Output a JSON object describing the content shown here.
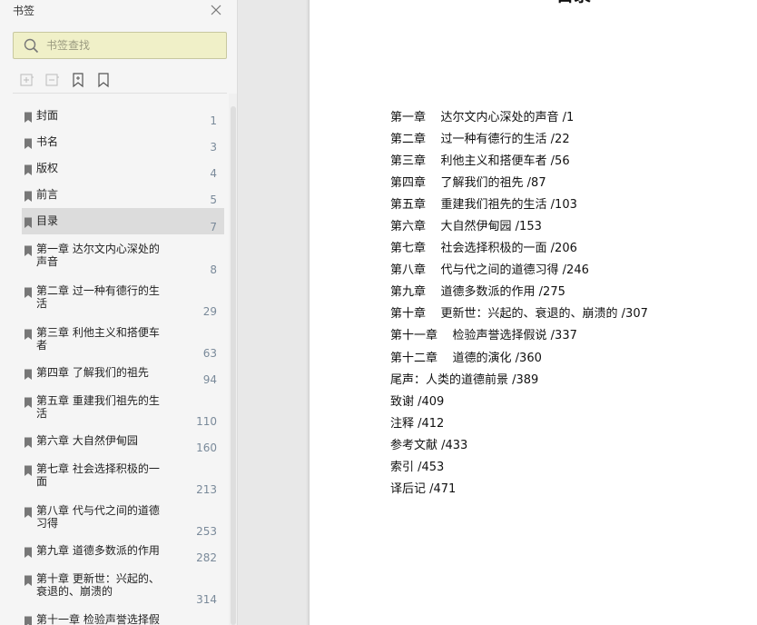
{
  "sidebar": {
    "title": "书签",
    "search": {
      "placeholder": "书签查找",
      "value": ""
    },
    "toolbar": {
      "expand_icon": "expand-all-icon",
      "collapse_icon": "collapse-all-icon",
      "add_bookmark_icon": "add-bookmark-icon",
      "bookmark_icon": "bookmark-icon"
    },
    "items": [
      {
        "label": "封面",
        "page": "1"
      },
      {
        "label": "书名",
        "page": "3"
      },
      {
        "label": "版权",
        "page": "4"
      },
      {
        "label": "前言",
        "page": "5"
      },
      {
        "label": "目录",
        "page": "7",
        "selected": true
      },
      {
        "label": "第一章  达尔文内心深处的声音",
        "page": "8"
      },
      {
        "label": "第二章  过一种有德行的生活",
        "page": "29"
      },
      {
        "label": "第三章  利他主义和搭便车者",
        "page": "63"
      },
      {
        "label": "第四章  了解我们的祖先",
        "page": "94"
      },
      {
        "label": "第五章  重建我们祖先的生活",
        "page": "110"
      },
      {
        "label": "第六章  大自然伊甸园",
        "page": "160"
      },
      {
        "label": "第七章  社会选择积极的一面",
        "page": "213"
      },
      {
        "label": "第八章  代与代之间的道德习得",
        "page": "253"
      },
      {
        "label": "第九章  道德多数派的作用",
        "page": "282"
      },
      {
        "label": "第十章  更新世：兴起的、衰退的、崩溃的",
        "page": "314"
      },
      {
        "label": "第十一章  检验声誉选择假",
        "page": ""
      }
    ]
  },
  "document": {
    "heading": "目录",
    "toc": [
      "第一章    达尔文内心深处的声音 /1",
      "第二章    过一种有德行的生活 /22",
      "第三章    利他主义和搭便车者 /56",
      "第四章    了解我们的祖先 /87",
      "第五章    重建我们祖先的生活 /103",
      "第六章    大自然伊甸园 /153",
      "第七章    社会选择积极的一面 /206",
      "第八章    代与代之间的道德习得 /246",
      "第九章    道德多数派的作用 /275",
      "第十章    更新世：兴起的、衰退的、崩溃的 /307",
      "第十一章    检验声誉选择假说 /337",
      "第十二章    道德的演化 /360",
      "尾声：人类的道德前景 /389",
      "致谢 /409",
      "注释 /412",
      "参考文献 /433",
      "索引 /453",
      "译后记 /471"
    ]
  }
}
